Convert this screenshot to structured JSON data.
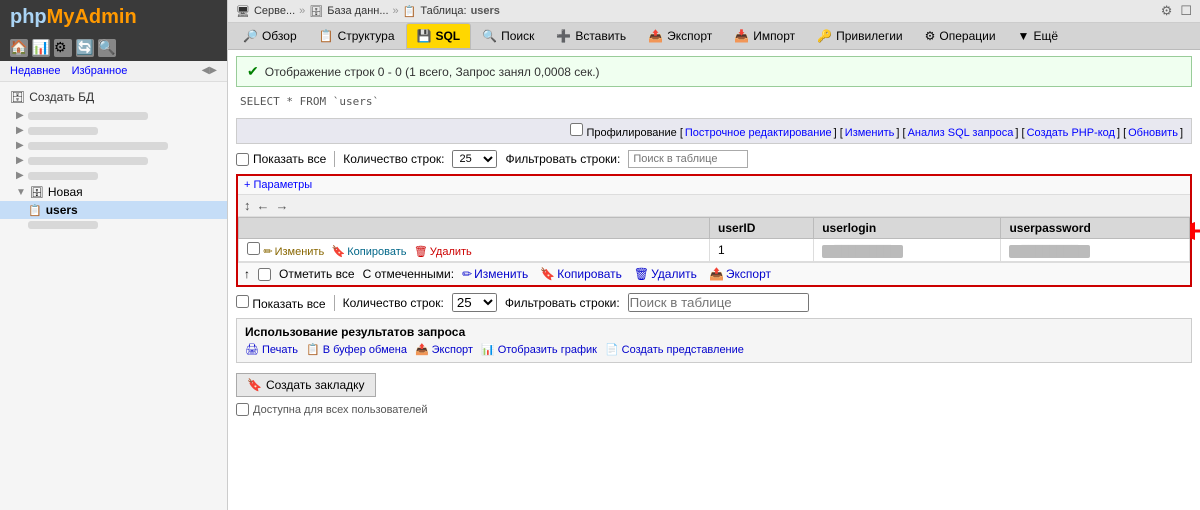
{
  "logo": {
    "php": "php",
    "myadmin": "MyAdmin"
  },
  "sidebar": {
    "nav_links": [
      "Недавнее",
      "Избранное"
    ],
    "create_db": "Создать БД",
    "items": [
      {
        "label": "",
        "type": "blur",
        "icon": "db"
      },
      {
        "label": "",
        "type": "blur",
        "icon": "db"
      },
      {
        "label": "",
        "type": "blur",
        "icon": "db"
      },
      {
        "label": "",
        "type": "blur",
        "icon": "db"
      },
      {
        "label": "",
        "type": "blur",
        "icon": "db"
      },
      {
        "label": "Новая",
        "type": "normal",
        "icon": "new"
      },
      {
        "label": "users",
        "type": "selected",
        "icon": "table"
      }
    ]
  },
  "breadcrumb": {
    "server": "Серве...",
    "database": "База данн...",
    "table_label": "Таблица:",
    "table": "users"
  },
  "top_icons": {
    "settings": "⚙",
    "monitor": "☐"
  },
  "toolbar": {
    "tabs": [
      {
        "id": "overview",
        "label": "Обзор",
        "icon": "🔎"
      },
      {
        "id": "structure",
        "label": "Структура",
        "icon": "📋"
      },
      {
        "id": "sql",
        "label": "SQL",
        "icon": "💾",
        "active": true
      },
      {
        "id": "search",
        "label": "Поиск",
        "icon": "🔍"
      },
      {
        "id": "insert",
        "label": "Вставить",
        "icon": "➕"
      },
      {
        "id": "export",
        "label": "Экспорт",
        "icon": "📤"
      },
      {
        "id": "import",
        "label": "Импорт",
        "icon": "📥"
      },
      {
        "id": "privileges",
        "label": "Привилегии",
        "icon": "🔑"
      },
      {
        "id": "operations",
        "label": "Операции",
        "icon": "⚙"
      },
      {
        "id": "more",
        "label": "Ещё",
        "icon": "▼"
      }
    ]
  },
  "success": {
    "message": "Отображение строк 0 - 0 (1 всего, Запрос занял 0,0008 сек.)"
  },
  "sql_query": "SELECT * FROM `users`",
  "options_bar": {
    "profiling": "Профилирование",
    "links": [
      "Построчное редактирование",
      "Изменить",
      "Анализ SQL запроса",
      "Создать PHP-код",
      "Обновить"
    ]
  },
  "controls": {
    "show_all": "Показать все",
    "row_count_label": "Количество строк:",
    "row_count_value": "25",
    "filter_label": "Фильтровать строки:",
    "filter_placeholder": "Поиск в таблице"
  },
  "result_table": {
    "params_link": "+ Параметры",
    "columns": [
      "",
      "userID",
      "userlogin",
      "userpassword"
    ],
    "rows": [
      {
        "userid": "1",
        "userlogin": "████████",
        "userpassword": "████████"
      }
    ],
    "row_actions": {
      "edit": "Изменить",
      "copy": "Копировать",
      "delete": "Удалить"
    }
  },
  "bottom_bar": {
    "select_all": "Отметить все",
    "with_selected": "С отмеченными:",
    "edit": "Изменить",
    "copy": "Копировать",
    "delete": "Удалить",
    "export": "Экспорт"
  },
  "use_results": {
    "title": "Использование результатов запроса",
    "links": [
      "Печать",
      "В буфер обмена",
      "Экспорт",
      "Отобразить график",
      "Создать представление"
    ]
  },
  "bookmark": {
    "label": "Создать закладку"
  },
  "footer": {
    "accessible": "Доступна для всех пользователей"
  }
}
